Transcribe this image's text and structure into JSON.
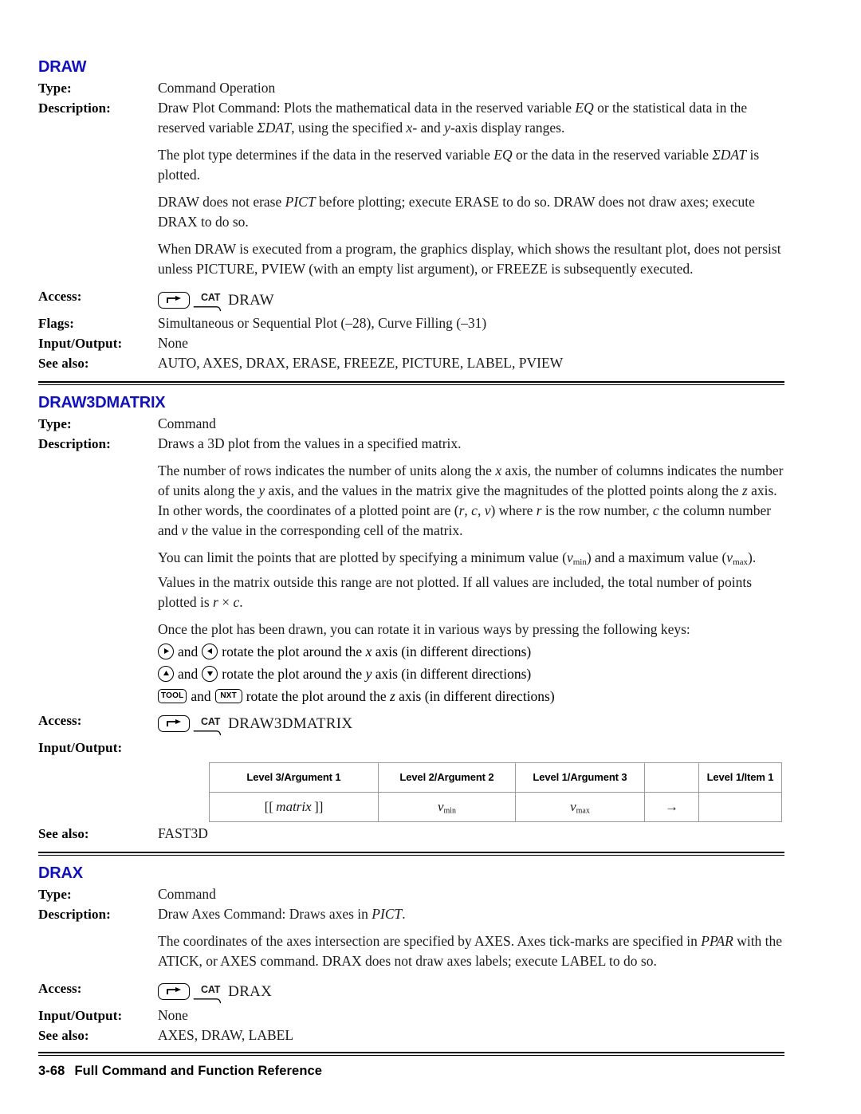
{
  "page": {
    "footer_page_number": "3-68",
    "footer_title": "Full Command and Function Reference",
    "heading_color": "#1111bb"
  },
  "labels": {
    "type": "Type:",
    "description": "Description:",
    "access": "Access:",
    "flags": "Flags:",
    "input_output": "Input/Output:",
    "input_output_colon": "Input/Output:",
    "see_also": "See also:"
  },
  "sections": [
    {
      "id": "draw",
      "heading": "DRAW",
      "type": "Command Operation",
      "description_paragraphs": [
        "Draw Plot Command: Plots the mathematical data in the reserved variable EQ or the statistical data in the reserved variable ΣDAT, using the specified x- and y-axis display ranges.",
        "The plot type determines if the data in the reserved variable EQ or the data in the reserved variable ΣDAT is plotted.",
        "DRAW does not erase PICT before plotting; execute ERASE to do so. DRAW does not draw axes; execute DRAX to do so.",
        "When DRAW is executed from a program, the graphics display, which shows the resultant plot, does not persist unless PICTURE, PVIEW (with an empty list argument), or FREEZE is subsequently executed."
      ],
      "access": {
        "shift_key_icon": "shift-right-key-icon",
        "menu_label": "CAT",
        "command_name": "DRAW"
      },
      "flags": "Simultaneous or Sequential Plot (–28), Curve Filling (–31)",
      "input_output": "None",
      "see_also": "AUTO, AXES, DRAX, ERASE, FREEZE, PICTURE, LABEL, PVIEW"
    },
    {
      "id": "draw3dmatrix",
      "heading": "DRAW3DMATRIX",
      "type": "Command",
      "description_first": "Draws a 3D plot from the values in a specified matrix.",
      "description_paragraphs": [
        "The number of rows indicates the number of units along the x axis, the number of columns indicates the number of units along the y axis, and the values in the matrix give the magnitudes of the plotted points along the z axis. In other words, the coordinates of a plotted point are (r, c, v) where r is the row number, c the column number and v the value in the corresponding cell of the matrix.",
        "You can limit the points that are plotted by specifying a minimum value (vmin) and a maximum value (vmax). Values in the matrix outside this range are not plotted. If all values are included, the total number of points plotted is r × c.",
        "Once the plot has been drawn, you can rotate it in various ways by pressing the following keys:"
      ],
      "key_rows": [
        {
          "key1_icon": "arrow-right-key-icon",
          "key1_label": "▶",
          "conjunction": "and",
          "key2_icon": "arrow-left-key-icon",
          "key2_label": "◀",
          "text": "rotate the plot around the x axis (in different directions)"
        },
        {
          "key1_icon": "arrow-up-key-icon",
          "key1_label": "▲",
          "conjunction": "and",
          "key2_icon": "arrow-down-key-icon",
          "key2_label": "▼",
          "text": "rotate the plot around the y axis (in different directions)"
        },
        {
          "key1_icon": "tool-key-icon",
          "key1_label": "TOOL",
          "conjunction": "and",
          "key2_icon": "nxt-key-icon",
          "key2_label": "NXT",
          "text": "rotate the plot around the z axis (in different directions)"
        }
      ],
      "access": {
        "shift_key_icon": "shift-right-key-icon",
        "menu_label": "CAT",
        "command_name": "DRAW3DMATRIX"
      },
      "io_table": {
        "headers": [
          "Level 3/Argument 1",
          "Level 2/Argument 2",
          "Level 1/Argument 3",
          "",
          "Level 1/Item 1"
        ],
        "rows": [
          [
            "[[ matrix ]]",
            "vmin",
            "vmax",
            "→",
            ""
          ]
        ]
      },
      "see_also": "FAST3D"
    },
    {
      "id": "drax",
      "heading": "DRAX",
      "type": "Command",
      "description_first": "Draw Axes Command: Draws axes in PICT.",
      "description_paragraphs": [
        "The coordinates of the axes intersection are specified by AXES. Axes tick-marks are specified in PPAR with the ATICK, or AXES command. DRAX does not draw axes labels; execute LABEL to do so."
      ],
      "access": {
        "shift_key_icon": "shift-right-key-icon",
        "menu_label": "CAT",
        "command_name": "DRAX"
      },
      "input_output": "None",
      "see_also": "AXES, DRAW, LABEL"
    }
  ]
}
